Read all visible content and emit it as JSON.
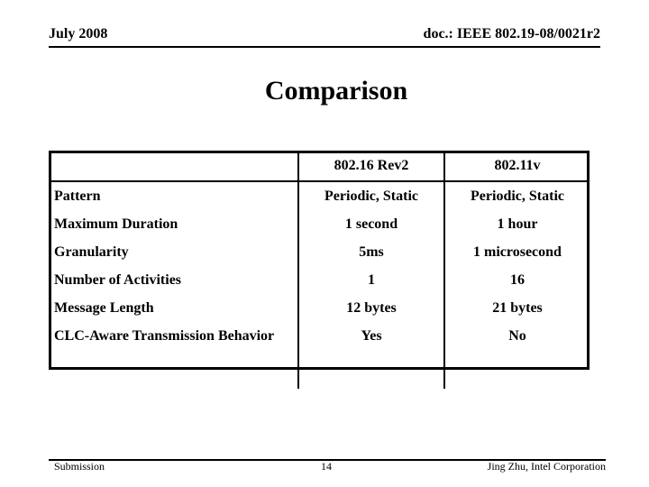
{
  "header": {
    "date": "July 2008",
    "doc_id": "doc.: IEEE 802.19-08/0021r2"
  },
  "title": "Comparison",
  "table": {
    "columns": [
      "",
      "802.16 Rev2",
      "802.11v"
    ],
    "rows": [
      {
        "label": "Pattern",
        "col1": "Periodic, Static",
        "col2": "Periodic, Static"
      },
      {
        "label": "Maximum Duration",
        "col1": "1 second",
        "col2": "1 hour"
      },
      {
        "label": "Granularity",
        "col1": "5ms",
        "col2": "1 microsecond"
      },
      {
        "label": "Number of Activities",
        "col1": "1",
        "col2": "16"
      },
      {
        "label": "Message Length",
        "col1": "12 bytes",
        "col2": "21 bytes"
      },
      {
        "label": "CLC-Aware Transmission Behavior",
        "col1": "Yes",
        "col2": "No"
      }
    ]
  },
  "footer": {
    "left": "Submission",
    "page_number": "14",
    "right": "Jing Zhu, Intel Corporation"
  }
}
